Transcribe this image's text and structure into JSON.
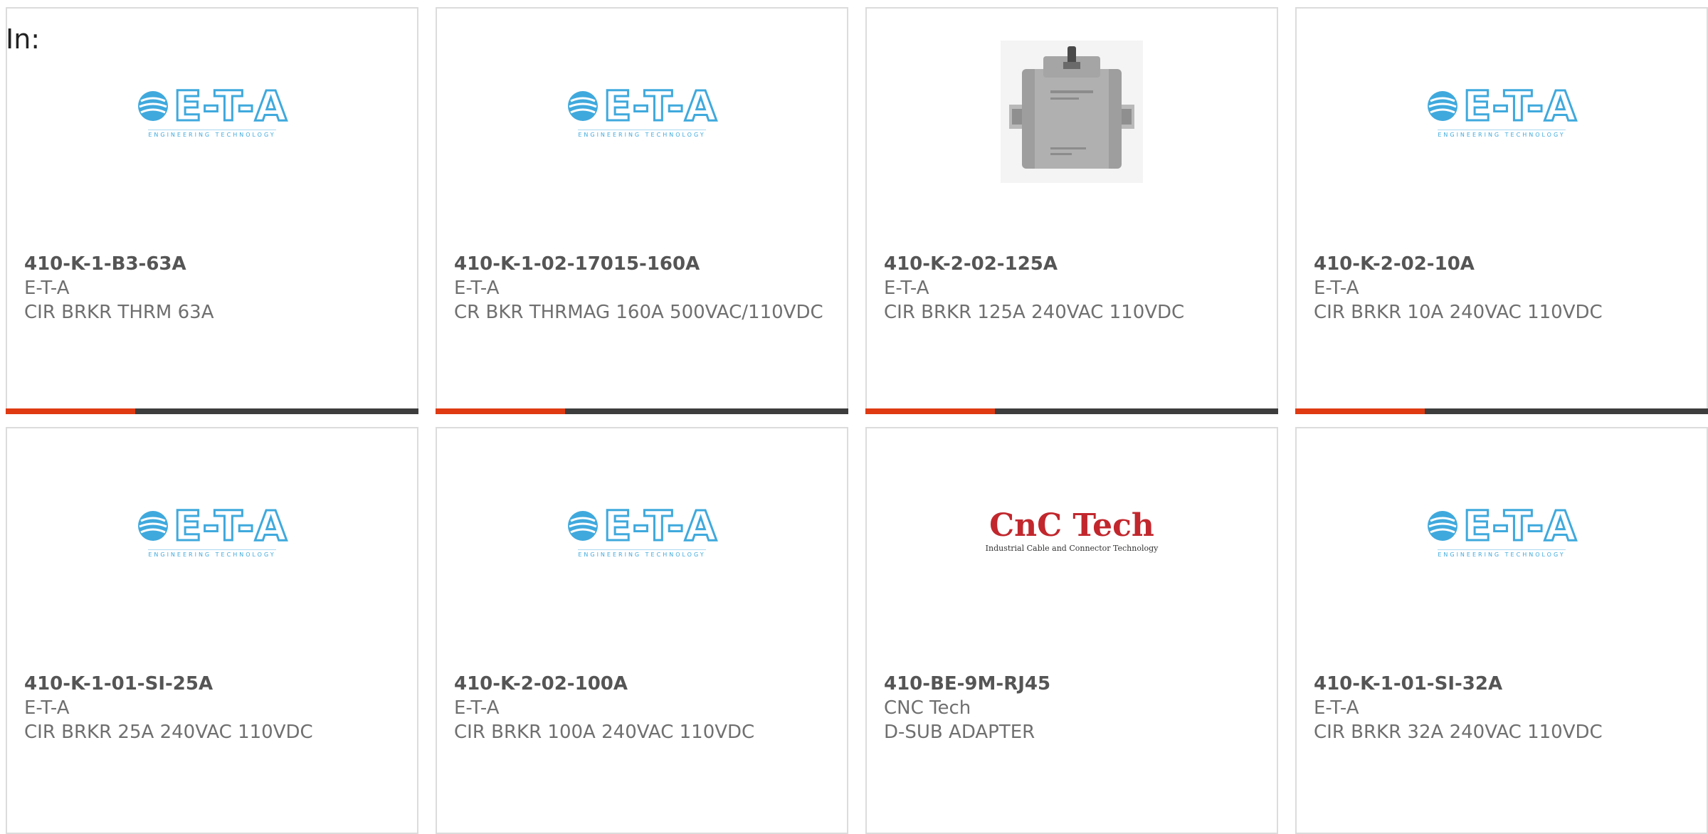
{
  "filter": {
    "label": "In:"
  },
  "products": [
    {
      "part_number": "410-K-1-B3-63A",
      "manufacturer": "E-T-A",
      "description": "CIR BRKR THRM 63A",
      "image": "eta-logo"
    },
    {
      "part_number": "410-K-1-02-17015-160A",
      "manufacturer": "E-T-A",
      "description": "CR BKR THRMAG 160A 500VAC/110VDC",
      "image": "eta-logo"
    },
    {
      "part_number": "410-K-2-02-125A",
      "manufacturer": "E-T-A",
      "description": "CIR BRKR 125A 240VAC 110VDC",
      "image": "circuit-breaker-photo"
    },
    {
      "part_number": "410-K-2-02-10A",
      "manufacturer": "E-T-A",
      "description": "CIR BRKR 10A 240VAC 110VDC",
      "image": "eta-logo"
    },
    {
      "part_number": "410-K-1-01-SI-25A",
      "manufacturer": "E-T-A",
      "description": "CIR BRKR 25A 240VAC 110VDC",
      "image": "eta-logo"
    },
    {
      "part_number": "410-K-2-02-100A",
      "manufacturer": "E-T-A",
      "description": "CIR BRKR 100A 240VAC 110VDC",
      "image": "eta-logo"
    },
    {
      "part_number": "410-BE-9M-RJ45",
      "manufacturer": "CNC Tech",
      "description": "D-SUB ADAPTER",
      "image": "cnc-tech-logo"
    },
    {
      "part_number": "410-K-1-01-SI-32A",
      "manufacturer": "E-T-A",
      "description": "CIR BRKR 32A 240VAC 110VDC",
      "image": "eta-logo"
    }
  ],
  "logos": {
    "eta": {
      "wordmark": "E-T-A",
      "tagline": "ENGINEERING TECHNOLOGY"
    },
    "cnc": {
      "wordmark": "CnC Tech",
      "tagline": "Industrial Cable and Connector Technology"
    }
  },
  "colors": {
    "accent": "#e03a12",
    "bar": "#3d3d3d",
    "eta_blue": "#3fa9dd",
    "cnc_red": "#c1272d"
  }
}
